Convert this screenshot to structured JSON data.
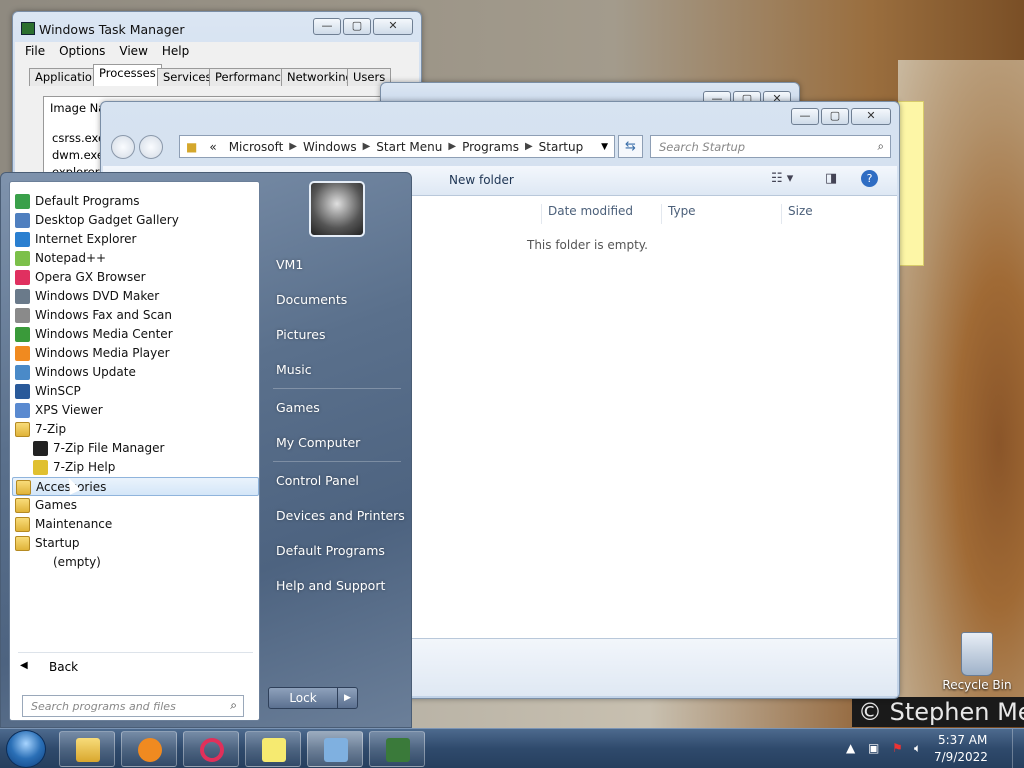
{
  "task_manager": {
    "title": "Windows Task Manager",
    "menu": [
      "File",
      "Options",
      "View",
      "Help"
    ],
    "tabs": [
      "Applications",
      "Processes",
      "Services",
      "Performance",
      "Networking",
      "Users"
    ],
    "active_tab": "Processes",
    "column": "Image Nam",
    "processes": [
      "csrss.exe",
      "dwm.exe",
      "explorer.e"
    ]
  },
  "explorer": {
    "breadcrumb": [
      "«",
      "Microsoft",
      "Windows",
      "Start Menu",
      "Programs",
      "Startup"
    ],
    "search_placeholder": "Search Startup",
    "toolbar": {
      "new_folder": "New folder"
    },
    "columns": [
      "Date modified",
      "Type",
      "Size"
    ],
    "empty_text": "This folder is empty."
  },
  "start_menu": {
    "programs": [
      {
        "label": "Default Programs",
        "icon": "default-programs-icon",
        "color": "#3aa04a"
      },
      {
        "label": "Desktop Gadget Gallery",
        "icon": "gadget-icon",
        "color": "#4f7fbf"
      },
      {
        "label": "Internet Explorer",
        "icon": "ie-icon",
        "color": "#2a7fd0"
      },
      {
        "label": "Notepad++",
        "icon": "notepadpp-icon",
        "color": "#7cc04a"
      },
      {
        "label": "Opera GX Browser",
        "icon": "opera-icon",
        "color": "#e03060"
      },
      {
        "label": "Windows DVD Maker",
        "icon": "dvd-icon",
        "color": "#6a7a8a"
      },
      {
        "label": "Windows Fax and Scan",
        "icon": "fax-icon",
        "color": "#8a8a8a"
      },
      {
        "label": "Windows Media Center",
        "icon": "media-center-icon",
        "color": "#3a9a3a"
      },
      {
        "label": "Windows Media Player",
        "icon": "media-player-icon",
        "color": "#f08a20"
      },
      {
        "label": "Windows Update",
        "icon": "update-icon",
        "color": "#4a8ac8"
      },
      {
        "label": "WinSCP",
        "icon": "winscp-icon",
        "color": "#2a5a9a"
      },
      {
        "label": "XPS Viewer",
        "icon": "xps-icon",
        "color": "#5a8ad0"
      },
      {
        "label": "7-Zip",
        "icon": "folder-icon",
        "folder": true
      },
      {
        "label": "7-Zip File Manager",
        "icon": "sevenzip-icon",
        "color": "#222222",
        "sub": true
      },
      {
        "label": "7-Zip Help",
        "icon": "help-icon",
        "color": "#e0c030",
        "sub": true
      },
      {
        "label": "Accessories",
        "icon": "folder-icon",
        "folder": true,
        "hover": true
      },
      {
        "label": "Games",
        "icon": "folder-icon",
        "folder": true
      },
      {
        "label": "Maintenance",
        "icon": "folder-icon",
        "folder": true
      },
      {
        "label": "Startup",
        "icon": "folder-icon",
        "folder": true
      },
      {
        "label": "(empty)",
        "icon": "",
        "sub": true,
        "plain": true
      }
    ],
    "back_label": "Back",
    "search_placeholder": "Search programs and files",
    "right_links": [
      "VM1",
      "Documents",
      "Pictures",
      "Music",
      "Games",
      "My Computer",
      "Control Panel",
      "Devices and Printers",
      "Default Programs",
      "Help and Support"
    ],
    "lock_label": "Lock"
  },
  "desktop": {
    "recycle_bin": "Recycle Bin",
    "watermark": "© Stephen Me"
  },
  "taskbar": {
    "time": "5:37 AM",
    "date": "7/9/2022"
  }
}
